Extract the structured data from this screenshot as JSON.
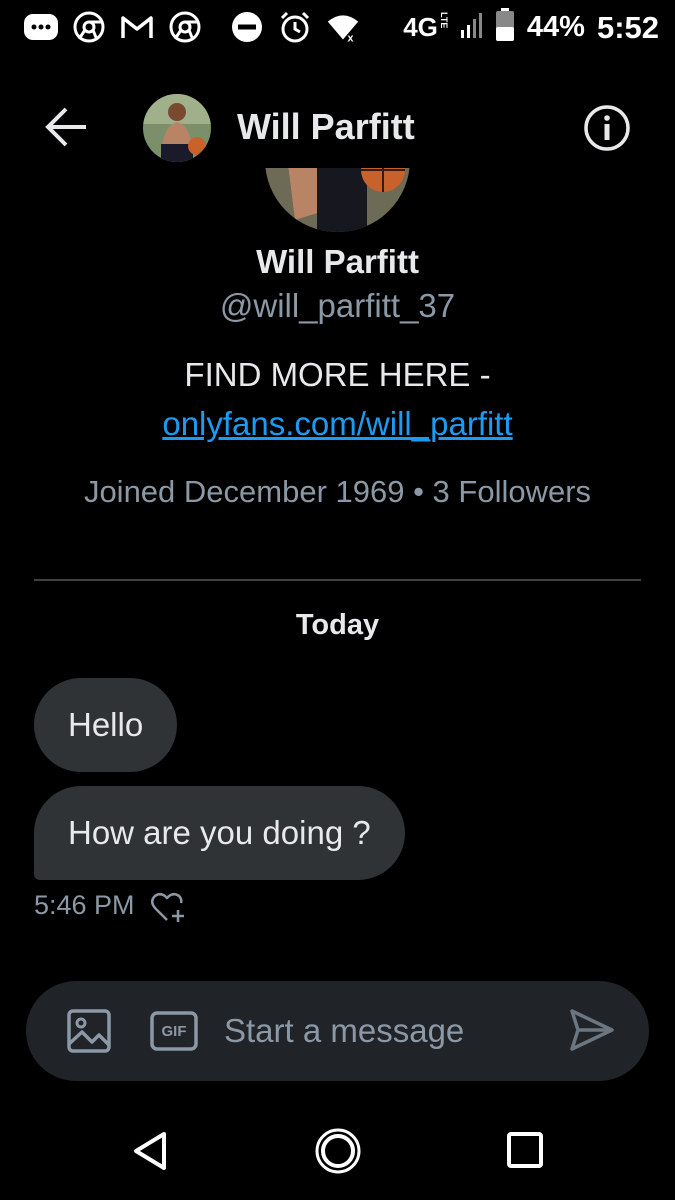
{
  "status_bar": {
    "left_icons": [
      "more-dots-icon",
      "chrome-icon",
      "gmail-icon",
      "chrome-icon",
      "do-not-disturb-icon",
      "alarm-icon",
      "wifi-icon"
    ],
    "network": "4G",
    "network_sub": "LTE",
    "battery": "44%",
    "time": "5:52"
  },
  "header": {
    "title": "Will Parfitt",
    "back_icon": "arrow-left-icon",
    "info_icon": "info-icon"
  },
  "profile": {
    "name": "Will Parfitt",
    "handle": "@will_parfitt_37",
    "bio": "FIND MORE HERE -",
    "link": "onlyfans.com/will_parfitt",
    "meta": "Joined December 1969 • 3 Followers"
  },
  "conversation": {
    "date_label": "Today",
    "messages": [
      {
        "text": "Hello"
      },
      {
        "text": "How are you doing ?"
      }
    ],
    "time": "5:46 PM"
  },
  "composer": {
    "placeholder": "Start a message",
    "gif_label": "GIF"
  },
  "colors": {
    "background": "#000000",
    "bubble": "#2f3336",
    "link": "#1d9bf0",
    "secondary_text": "#8b98a5",
    "composer": "#202327"
  }
}
